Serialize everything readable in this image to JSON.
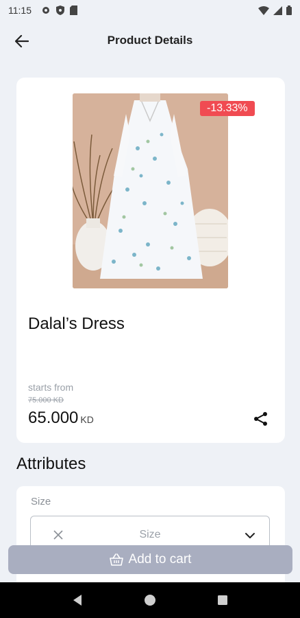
{
  "status_bar": {
    "time": "11:15",
    "icons": [
      "gear-icon",
      "shield-icon",
      "sim-card-icon",
      "wifi-icon",
      "signal-icon",
      "battery-icon"
    ]
  },
  "header": {
    "title": "Product Details",
    "back_icon": "arrow-left-icon"
  },
  "product": {
    "name": "Dalal’s Dress",
    "discount": "-13.33%",
    "starts_from_label": "starts from",
    "old_price": "75.000 KD",
    "price": "65.000",
    "currency": "KD",
    "share_icon": "share-icon"
  },
  "attributes": {
    "title": "Attributes",
    "size_label": "Size",
    "size_select_value": "Size"
  },
  "cart": {
    "add_label": "Add to cart",
    "icon": "basket-icon"
  },
  "colors": {
    "background": "#eef1f6",
    "badge": "#f04b52",
    "cart_button": "#a9aec0"
  }
}
